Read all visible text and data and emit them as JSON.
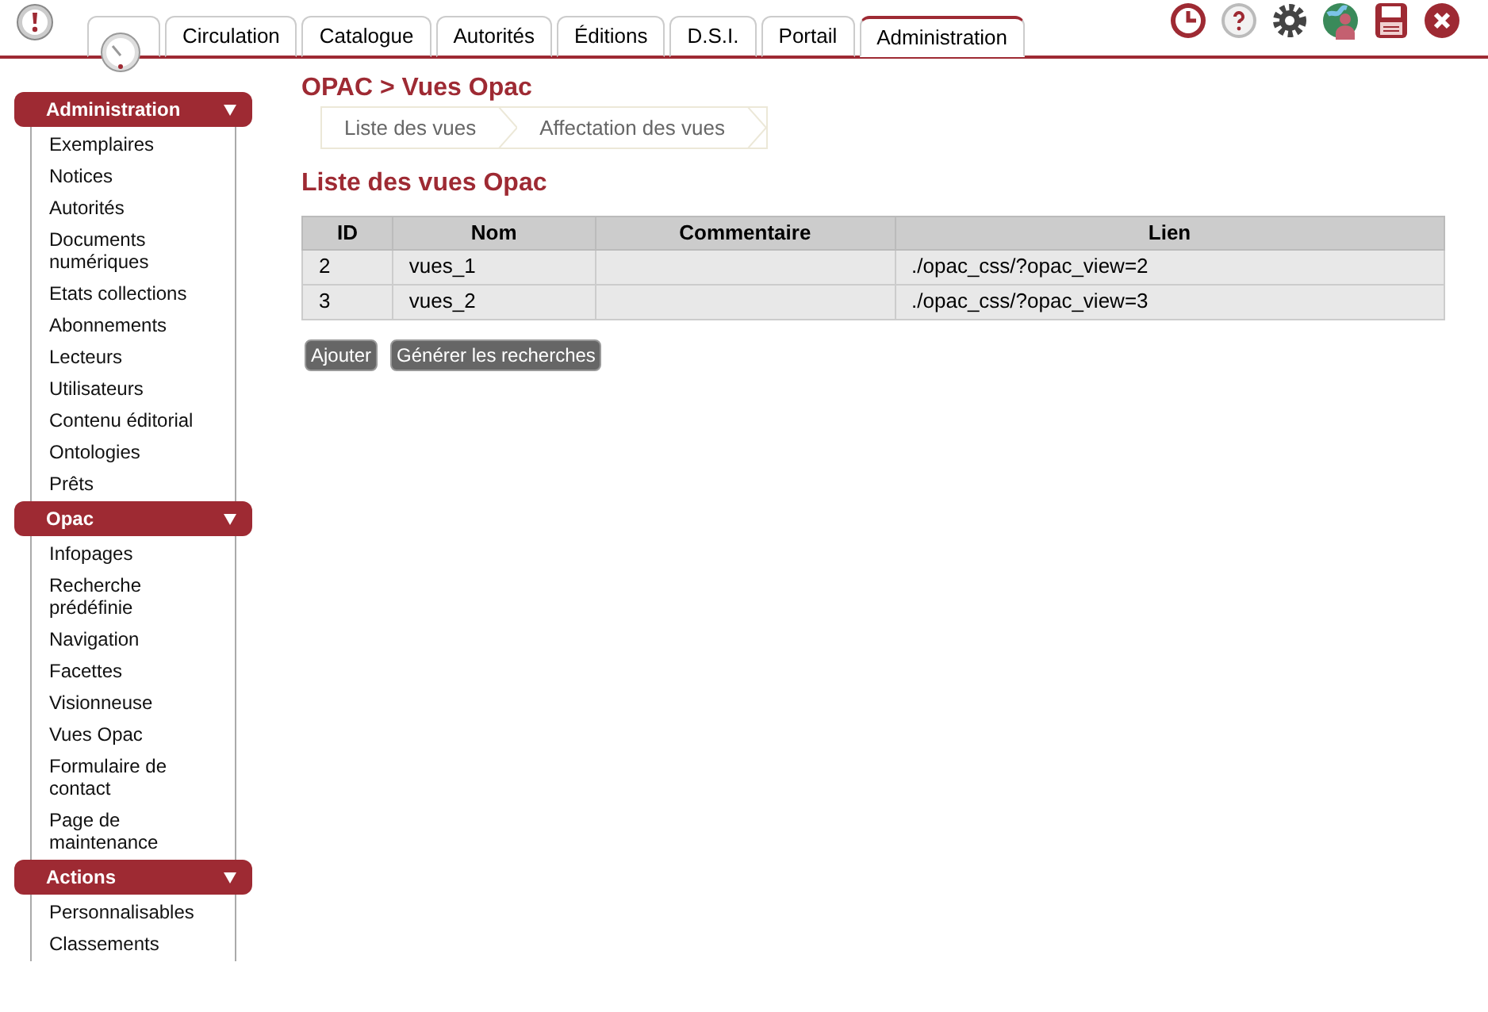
{
  "tabs": [
    {
      "kind": "icon",
      "selected": false
    },
    {
      "kind": "text",
      "label": "Circulation",
      "selected": false
    },
    {
      "kind": "text",
      "label": "Catalogue",
      "selected": false
    },
    {
      "kind": "text",
      "label": "Autorités",
      "selected": false
    },
    {
      "kind": "text",
      "label": "Éditions",
      "selected": false
    },
    {
      "kind": "text",
      "label": "D.S.I.",
      "selected": false
    },
    {
      "kind": "text",
      "label": "Portail",
      "selected": false
    },
    {
      "kind": "text",
      "label": "Administration",
      "selected": true
    }
  ],
  "sidebar": [
    {
      "title": "Administration",
      "expanded": true,
      "items": [
        "Exemplaires",
        "Notices",
        "Autorités",
        "Documents numériques",
        "Etats collections",
        "Abonnements",
        "Lecteurs",
        "Utilisateurs",
        "Contenu éditorial",
        "Ontologies",
        "Prêts"
      ]
    },
    {
      "title": "Opac",
      "expanded": true,
      "items": [
        "Infopages",
        "Recherche prédéfinie",
        "Navigation",
        "Facettes",
        "Visionneuse",
        "Vues Opac",
        "Formulaire de contact",
        "Page de maintenance"
      ]
    },
    {
      "title": "Actions",
      "expanded": true,
      "items": [
        "Personnalisables",
        "Classements"
      ]
    }
  ],
  "page_title": "OPAC > Vues Opac",
  "subtabs": [
    "Liste des vues",
    "Affectation des vues"
  ],
  "section_title": "Liste des vues Opac",
  "table": {
    "columns": [
      "ID",
      "Nom",
      "Commentaire",
      "Lien"
    ],
    "rows": [
      [
        "2",
        "vues_1",
        "",
        "./opac_css/?opac_view=2"
      ],
      [
        "3",
        "vues_2",
        "",
        "./opac_css/?opac_view=3"
      ]
    ]
  },
  "buttons": [
    "Ajouter",
    "Générer les recherches"
  ]
}
